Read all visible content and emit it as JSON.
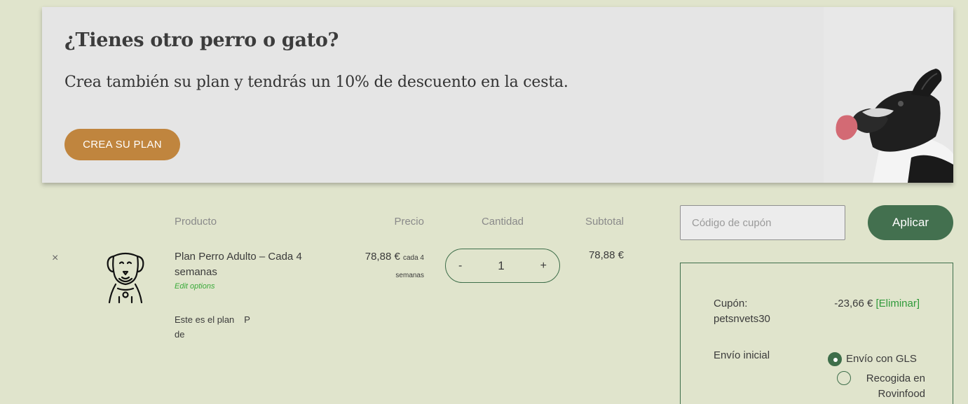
{
  "promo": {
    "title": "¿Tienes otro perro o gato?",
    "subtitle": "Crea también su plan y tendrás un 10% de descuento en la cesta.",
    "button_label": "CREA SU PLAN",
    "image": "dog-licking-lips"
  },
  "cart": {
    "headers": {
      "product": "Producto",
      "price": "Precio",
      "quantity": "Cantidad",
      "subtotal": "Subtotal"
    },
    "item": {
      "remove_label": "×",
      "thumbnail_icon": "dog-outline-icon",
      "name": "Plan Perro Adulto – Cada 4 semanas",
      "edit_label": "Edit options",
      "description_line1": "Este es el plan",
      "description_extra": "P",
      "description_line2": "de",
      "price": "78,88 €",
      "price_period": "cada 4 semanas",
      "qty_minus": "-",
      "qty_value": "1",
      "qty_plus": "+",
      "subtotal": "78,88 €"
    }
  },
  "coupon": {
    "placeholder": "Código de cupón",
    "apply_label": "Aplicar"
  },
  "totals": {
    "coupon_label": "Cupón: petsnvets30",
    "coupon_amount": "-23,66 €",
    "coupon_remove": "[Eliminar]",
    "shipping_label": "Envío inicial",
    "shipping_options": [
      {
        "label": "Envío con GLS",
        "selected": true
      },
      {
        "label": "Recogida en Rovinfood",
        "selected": false
      }
    ]
  },
  "colors": {
    "background": "#e0e4cc",
    "accent_orange": "#c0853e",
    "accent_green": "#43704f",
    "link_green": "#2f9a3a"
  }
}
